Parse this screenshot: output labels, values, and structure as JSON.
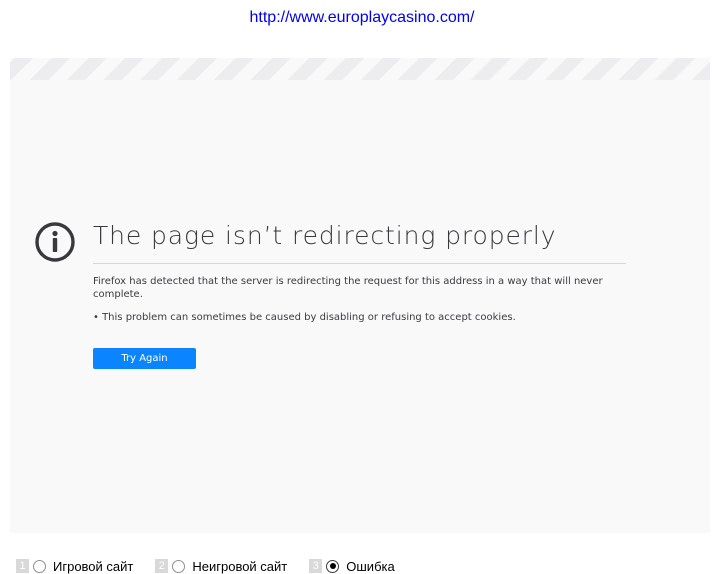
{
  "url": "http://www.europlaycasino.com/",
  "error_page": {
    "title": "The page isn’t redirecting properly",
    "description": "Firefox has detected that the server is redirecting the request for this address in a way that will never complete.",
    "hint": "• This problem can sometimes be caused by disabling or refusing to accept cookies.",
    "button_label": "Try Again",
    "icon": "info-icon",
    "accent_color": "#0a84ff"
  },
  "options": [
    {
      "number": "1",
      "label": "Игровой сайт",
      "selected": false
    },
    {
      "number": "2",
      "label": "Неигровой сайт",
      "selected": false
    },
    {
      "number": "3",
      "label": "Ошибка",
      "selected": true
    }
  ]
}
